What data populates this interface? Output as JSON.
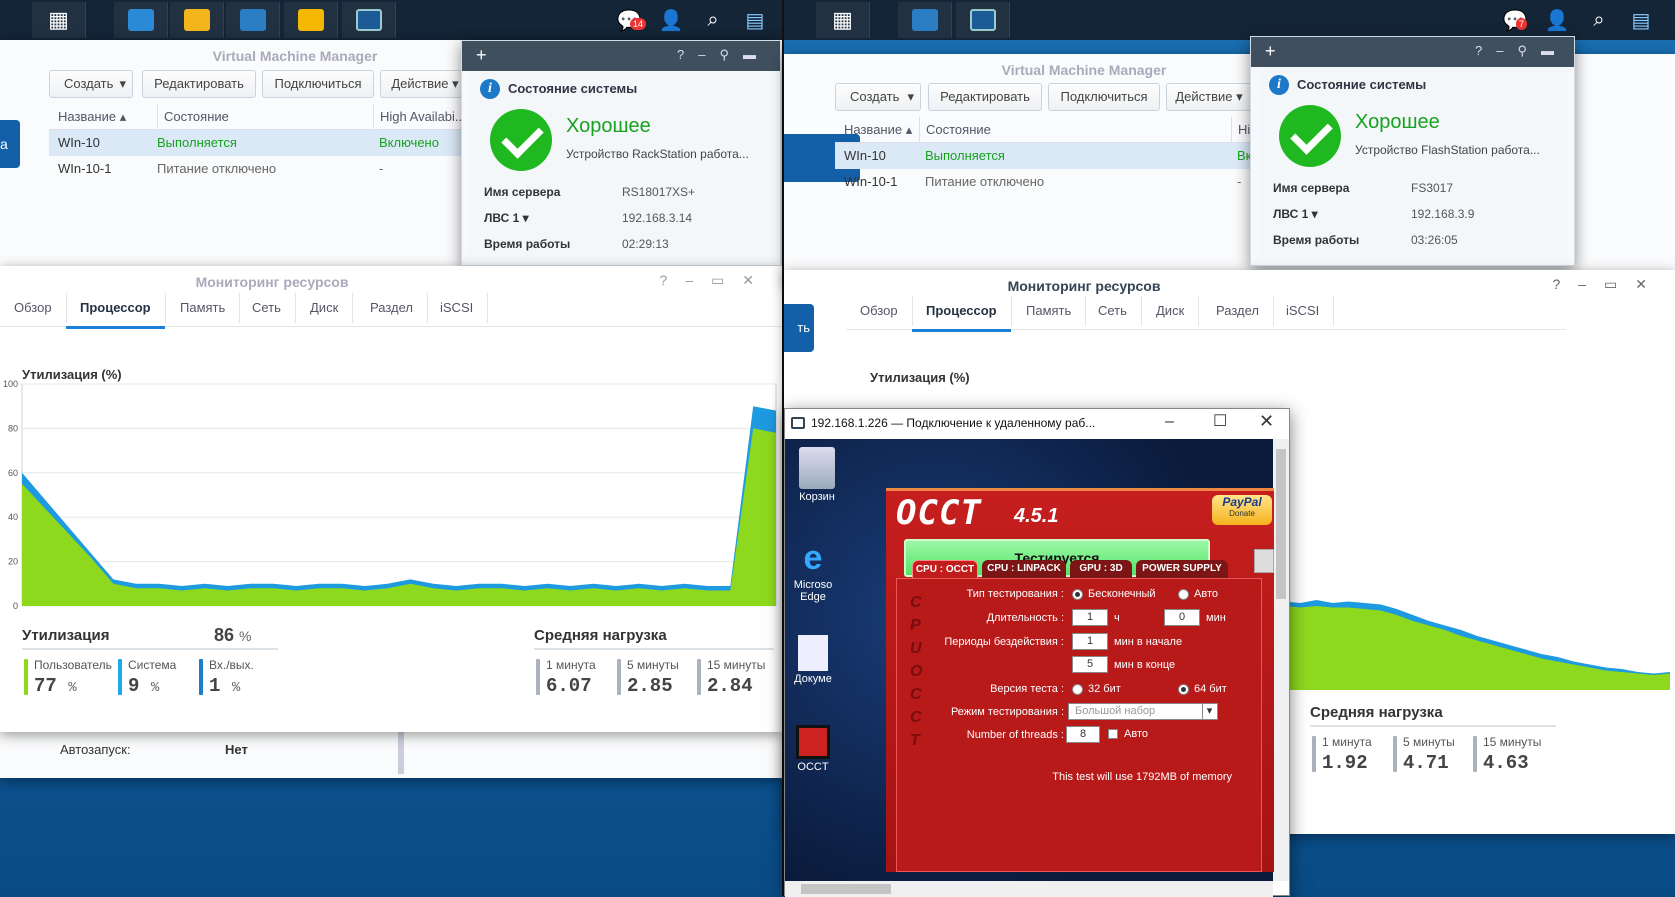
{
  "left": {
    "taskbar": {
      "badge": "14"
    },
    "vmm": {
      "title": "Virtual Machine Manager",
      "toolbar": {
        "create": "Создать",
        "edit": "Редактировать",
        "connect": "Подключиться",
        "action": "Действие"
      },
      "columns": [
        "Название ▴",
        "Состояние",
        "High Availabi..."
      ],
      "rows": [
        {
          "name": "WIn-10",
          "state": "Выполняется",
          "ha": "Включено"
        },
        {
          "name": "WIn-10-1",
          "state": "Питание отключено",
          "ha": "-"
        }
      ],
      "autostart_label": "Автозапуск:",
      "autostart_value": "Нет"
    },
    "status": {
      "title": "Состояние системы",
      "state": "Хорошее",
      "desc": "Устройство RackStation работа...",
      "server_label": "Имя сервера",
      "server": "RS18017XS+",
      "lan_label": "ЛВС 1 ▾",
      "ip": "192.168.3.14",
      "uptime_label": "Время работы",
      "uptime": "02:29:13"
    },
    "monitor": {
      "title": "Мониторинг ресурсов",
      "tabs": [
        "Обзор",
        "Процессор",
        "Память",
        "Сеть",
        "Диск",
        "Раздел",
        "iSCSI"
      ],
      "chart_title": "Утилизация (%)",
      "util_label": "Утилизация",
      "util_value": "86",
      "user_label": "Пользователь",
      "user_value": "77",
      "system_label": "Система",
      "system_value": "9",
      "io_label": "Вх./вых.",
      "io_value": "1",
      "pct": "%",
      "load_label": "Средняя нагрузка",
      "load": [
        {
          "label": "1 минута",
          "value": "6.07"
        },
        {
          "label": "5 минуты",
          "value": "2.85"
        },
        {
          "label": "15 минуты",
          "value": "2.84"
        }
      ]
    }
  },
  "right": {
    "taskbar": {
      "badge": "7"
    },
    "vmm": {
      "title": "Virtual Machine Manager",
      "toolbar": {
        "create": "Создать",
        "edit": "Редактировать",
        "connect": "Подключиться",
        "action": "Действие"
      },
      "columns": [
        "Название ▴",
        "Состояние",
        "Hig"
      ],
      "rows": [
        {
          "name": "WIn-10",
          "state": "Выполняется",
          "ha": "Вкл"
        },
        {
          "name": "WIn-10-1",
          "state": "Питание отключено",
          "ha": "-"
        }
      ]
    },
    "status": {
      "title": "Состояние системы",
      "state": "Хорошее",
      "desc": "Устройство FlashStation работа...",
      "server_label": "Имя сервера",
      "server": "FS3017",
      "lan_label": "ЛВС 1 ▾",
      "ip": "192.168.3.9",
      "uptime_label": "Время работы",
      "uptime": "03:26:05"
    },
    "monitor": {
      "title": "Мониторинг ресурсов",
      "tabs": [
        "Обзор",
        "Процессор",
        "Память",
        "Сеть",
        "Диск",
        "Раздел",
        "iSCSI"
      ],
      "chart_title": "Утилизация (%)",
      "load_label": "Средняя нагрузка",
      "load": [
        {
          "label": "1 минута",
          "value": "1.92"
        },
        {
          "label": "5 минуты",
          "value": "4.71"
        },
        {
          "label": "15 минуты",
          "value": "4.63"
        }
      ]
    },
    "blue_button_fragment": "а",
    "blue_button_fragment2": "ть"
  },
  "rdp": {
    "title": "192.168.1.226 — Подключение к удаленному раб...",
    "desktop_icons": [
      "Корзин",
      "Microso Edge",
      "Докуме",
      "OCCT"
    ]
  },
  "occt": {
    "logo": "OCCT",
    "version": "4.5.1",
    "paypal": "PayPal",
    "donate": "Donate",
    "run_button": "Тестируется",
    "tabs": [
      "CPU : OCCT",
      "CPU : LINPACK",
      "GPU : 3D",
      "POWER SUPPLY"
    ],
    "side_text": [
      "C",
      "P",
      "U",
      "",
      "O",
      "C",
      "C",
      "T"
    ],
    "test_type_label": "Тип тестирования :",
    "infinite": "Бесконечный",
    "auto": "Авто",
    "duration_label": "Длительность :",
    "duration_h": "1",
    "h": "ч",
    "duration_m": "0",
    "m": "мин",
    "idle_label": "Периоды бездействия :",
    "idle_start": "1",
    "idle_start_text": "мин в начале",
    "idle_end": "5",
    "idle_end_text": "мин в конце",
    "version_label": "Версия теста :",
    "v32": "32 бит",
    "v64": "64 бит",
    "mode_label": "Режим тестирования :",
    "mode": "Большой набор",
    "threads_label": "Number of threads :",
    "threads": "8",
    "threads_auto": "Авто",
    "memory_note": "This test will use 1792MB of memory"
  },
  "chart_data": [
    {
      "type": "area",
      "title": "Утилизация (%)",
      "ylim": [
        0,
        100
      ],
      "yticks": [
        0,
        20,
        40,
        60,
        80,
        100
      ],
      "series": [
        {
          "values": [
            60,
            48,
            36,
            24,
            12,
            10,
            10,
            9,
            10,
            9,
            10,
            10,
            9,
            10,
            10,
            9,
            10,
            12,
            10,
            9,
            10,
            10,
            9,
            10,
            9,
            10,
            9,
            10,
            9,
            10,
            9,
            9,
            90,
            88
          ]
        },
        {
          "values": [
            55,
            44,
            33,
            22,
            10,
            8,
            8,
            7,
            8,
            7,
            8,
            8,
            7,
            8,
            8,
            7,
            8,
            10,
            8,
            7,
            8,
            8,
            7,
            8,
            7,
            8,
            7,
            8,
            7,
            8,
            7,
            7,
            80,
            78
          ]
        }
      ]
    },
    {
      "type": "area",
      "title": "Утилизация (%)",
      "series": [
        {
          "values": [
            58,
            57,
            58,
            57,
            58,
            59,
            58,
            60,
            58,
            59,
            58,
            57,
            54,
            50,
            46,
            43,
            40,
            36,
            33,
            30,
            27,
            24,
            22,
            19,
            17,
            15,
            14,
            12,
            11,
            12
          ]
        },
        {
          "values": [
            55,
            54,
            55,
            54,
            55,
            56,
            55,
            56,
            55,
            55,
            54,
            53,
            50,
            46,
            43,
            40,
            36,
            33,
            30,
            27,
            24,
            21,
            19,
            17,
            15,
            13,
            12,
            11,
            10,
            11
          ]
        }
      ]
    }
  ],
  "colors": {
    "green": "#8ed81e",
    "blue": "#1e9ae0",
    "occt_red": "#b71c1c"
  }
}
